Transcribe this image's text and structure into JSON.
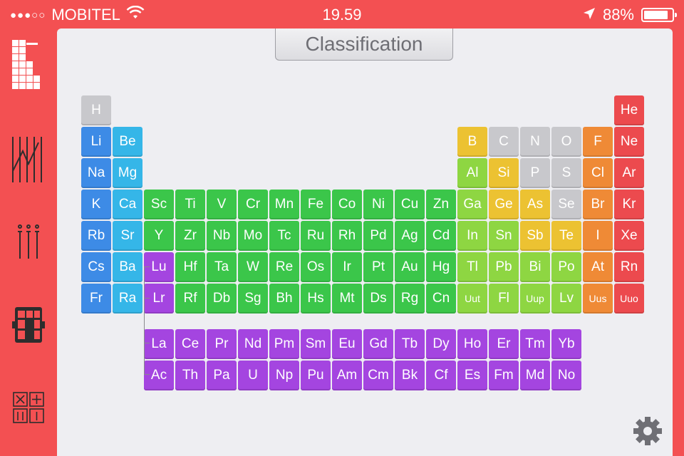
{
  "status_bar": {
    "carrier": "MOBITEL",
    "signal_dots": "●●●○○",
    "time": "19.59",
    "battery": "88%",
    "battery_level": 0.88
  },
  "header": {
    "title": "Classification"
  },
  "colors": {
    "gray": "#c8c8cc",
    "blue": "#3d8be6",
    "lightblue": "#35b6e8",
    "green": "#3bc64a",
    "yellowgreen": "#8ed642",
    "yellow": "#ecc232",
    "orange": "#ef8a36",
    "red": "#ec4a4e",
    "purple": "#a445e0"
  },
  "sidebar": [
    "table-icon",
    "scale-icon",
    "test-tubes-icon",
    "grid-icon",
    "calculator-icon"
  ],
  "elements": [
    [
      "H",
      "gray"
    ],
    [
      "He",
      "red"
    ],
    [
      "Li",
      "blue"
    ],
    [
      "Be",
      "lightblue"
    ],
    [
      "B",
      "yellow"
    ],
    [
      "C",
      "gray"
    ],
    [
      "N",
      "gray"
    ],
    [
      "O",
      "gray"
    ],
    [
      "F",
      "orange"
    ],
    [
      "Ne",
      "red"
    ],
    [
      "Na",
      "blue"
    ],
    [
      "Mg",
      "lightblue"
    ],
    [
      "Al",
      "yellowgreen"
    ],
    [
      "Si",
      "yellow"
    ],
    [
      "P",
      "gray"
    ],
    [
      "S",
      "gray"
    ],
    [
      "Cl",
      "orange"
    ],
    [
      "Ar",
      "red"
    ],
    [
      "K",
      "blue"
    ],
    [
      "Ca",
      "lightblue"
    ],
    [
      "Sc",
      "green"
    ],
    [
      "Ti",
      "green"
    ],
    [
      "V",
      "green"
    ],
    [
      "Cr",
      "green"
    ],
    [
      "Mn",
      "green"
    ],
    [
      "Fe",
      "green"
    ],
    [
      "Co",
      "green"
    ],
    [
      "Ni",
      "green"
    ],
    [
      "Cu",
      "green"
    ],
    [
      "Zn",
      "green"
    ],
    [
      "Ga",
      "yellowgreen"
    ],
    [
      "Ge",
      "yellow"
    ],
    [
      "As",
      "yellow"
    ],
    [
      "Se",
      "gray"
    ],
    [
      "Br",
      "orange"
    ],
    [
      "Kr",
      "red"
    ],
    [
      "Rb",
      "blue"
    ],
    [
      "Sr",
      "lightblue"
    ],
    [
      "Y",
      "green"
    ],
    [
      "Zr",
      "green"
    ],
    [
      "Nb",
      "green"
    ],
    [
      "Mo",
      "green"
    ],
    [
      "Tc",
      "green"
    ],
    [
      "Ru",
      "green"
    ],
    [
      "Rh",
      "green"
    ],
    [
      "Pd",
      "green"
    ],
    [
      "Ag",
      "green"
    ],
    [
      "Cd",
      "green"
    ],
    [
      "In",
      "yellowgreen"
    ],
    [
      "Sn",
      "yellowgreen"
    ],
    [
      "Sb",
      "yellow"
    ],
    [
      "Te",
      "yellow"
    ],
    [
      "I",
      "orange"
    ],
    [
      "Xe",
      "red"
    ],
    [
      "Cs",
      "blue"
    ],
    [
      "Ba",
      "lightblue"
    ],
    [
      "Lu",
      "purple"
    ],
    [
      "Hf",
      "green"
    ],
    [
      "Ta",
      "green"
    ],
    [
      "W",
      "green"
    ],
    [
      "Re",
      "green"
    ],
    [
      "Os",
      "green"
    ],
    [
      "Ir",
      "green"
    ],
    [
      "Pt",
      "green"
    ],
    [
      "Au",
      "green"
    ],
    [
      "Hg",
      "green"
    ],
    [
      "Tl",
      "yellowgreen"
    ],
    [
      "Pb",
      "yellowgreen"
    ],
    [
      "Bi",
      "yellowgreen"
    ],
    [
      "Po",
      "yellowgreen"
    ],
    [
      "At",
      "orange"
    ],
    [
      "Rn",
      "red"
    ],
    [
      "Fr",
      "blue"
    ],
    [
      "Ra",
      "lightblue"
    ],
    [
      "Lr",
      "purple"
    ],
    [
      "Rf",
      "green"
    ],
    [
      "Db",
      "green"
    ],
    [
      "Sg",
      "green"
    ],
    [
      "Bh",
      "green"
    ],
    [
      "Hs",
      "green"
    ],
    [
      "Mt",
      "green"
    ],
    [
      "Ds",
      "green"
    ],
    [
      "Rg",
      "green"
    ],
    [
      "Cn",
      "green"
    ],
    [
      "Uut",
      "yellowgreen"
    ],
    [
      "Fl",
      "yellowgreen"
    ],
    [
      "Uup",
      "yellowgreen"
    ],
    [
      "Lv",
      "yellowgreen"
    ],
    [
      "Uus",
      "orange"
    ],
    [
      "Uuo",
      "red"
    ],
    [
      "La",
      "purple"
    ],
    [
      "Ce",
      "purple"
    ],
    [
      "Pr",
      "purple"
    ],
    [
      "Nd",
      "purple"
    ],
    [
      "Pm",
      "purple"
    ],
    [
      "Sm",
      "purple"
    ],
    [
      "Eu",
      "purple"
    ],
    [
      "Gd",
      "purple"
    ],
    [
      "Tb",
      "purple"
    ],
    [
      "Dy",
      "purple"
    ],
    [
      "Ho",
      "purple"
    ],
    [
      "Er",
      "purple"
    ],
    [
      "Tm",
      "purple"
    ],
    [
      "Yb",
      "purple"
    ],
    [
      "Ac",
      "purple"
    ],
    [
      "Th",
      "purple"
    ],
    [
      "Pa",
      "purple"
    ],
    [
      "U",
      "purple"
    ],
    [
      "Np",
      "purple"
    ],
    [
      "Pu",
      "purple"
    ],
    [
      "Am",
      "purple"
    ],
    [
      "Cm",
      "purple"
    ],
    [
      "Bk",
      "purple"
    ],
    [
      "Cf",
      "purple"
    ],
    [
      "Es",
      "purple"
    ],
    [
      "Fm",
      "purple"
    ],
    [
      "Md",
      "purple"
    ],
    [
      "No",
      "purple"
    ]
  ]
}
